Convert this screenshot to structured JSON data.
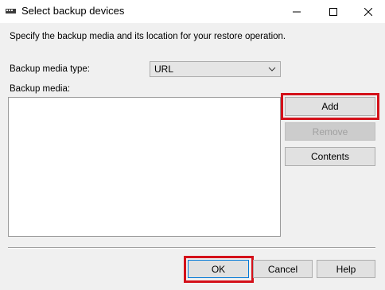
{
  "window": {
    "title": "Select backup devices"
  },
  "title_controls": {
    "minimize_icon": "minimize-icon",
    "maximize_icon": "maximize-icon",
    "close_icon": "close-icon"
  },
  "main": {
    "instructions": "Specify the backup media and its location for your restore operation.",
    "media_type_label": "Backup media type:",
    "media_type_value": "URL",
    "media_label": "Backup media:",
    "media_items": []
  },
  "side_buttons": {
    "add": "Add",
    "remove": "Remove",
    "contents": "Contents"
  },
  "footer": {
    "ok": "OK",
    "cancel": "Cancel",
    "help": "Help"
  },
  "colors": {
    "highlight": "#d4111a",
    "background": "#f0f0f0",
    "default_button_border": "#0078d7"
  }
}
